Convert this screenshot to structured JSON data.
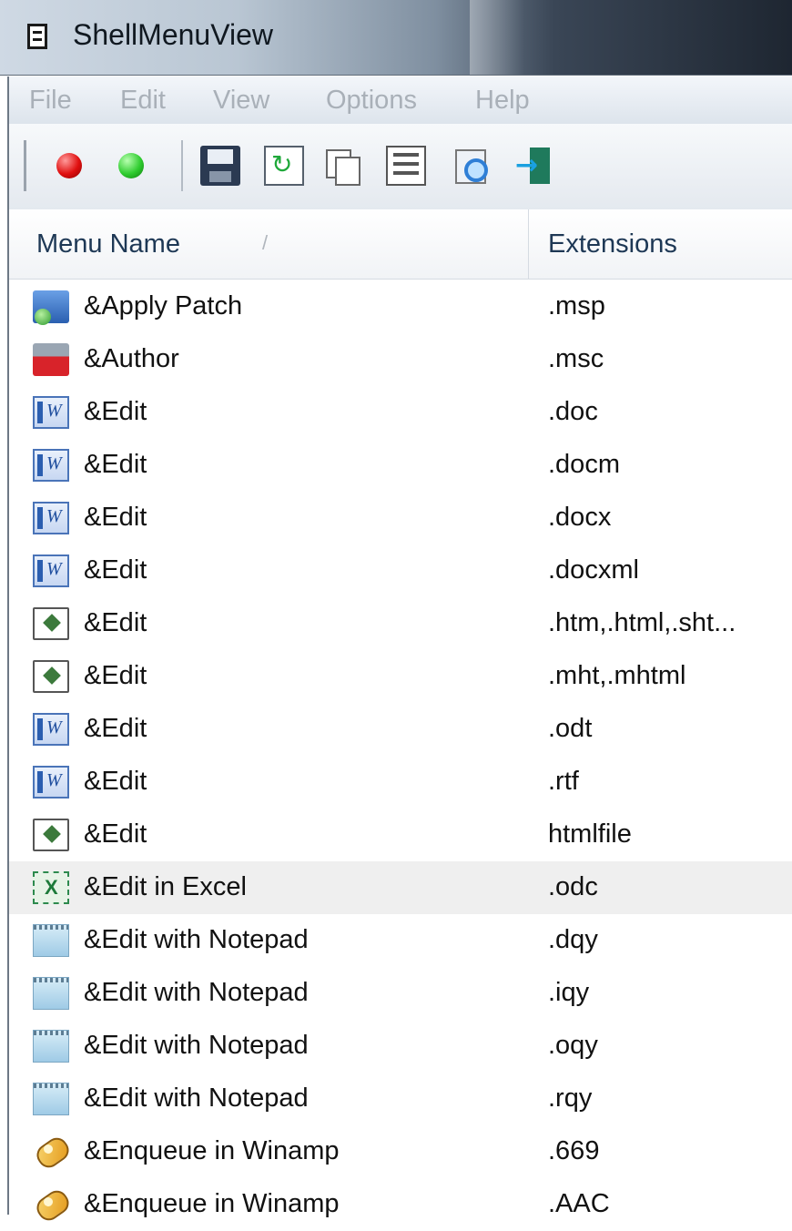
{
  "window": {
    "title": "ShellMenuView"
  },
  "menubar": {
    "items": [
      "File",
      "Edit",
      "View",
      "Options",
      "Help"
    ]
  },
  "toolbar": {
    "buttons": [
      "red-dot-icon",
      "green-dot-icon",
      "save-icon",
      "refresh-icon",
      "copy-icon",
      "properties-icon",
      "find-icon",
      "exit-icon"
    ]
  },
  "list": {
    "columns": [
      "Menu Name",
      "Extensions"
    ],
    "sort_indicator": "/",
    "rows": [
      {
        "name": "&Apply Patch",
        "ext": ".msp",
        "icon": "msi-patch-icon"
      },
      {
        "name": "&Author",
        "ext": ".msc",
        "icon": "mmc-author-icon"
      },
      {
        "name": "&Edit",
        "ext": ".doc",
        "icon": "word-icon"
      },
      {
        "name": "&Edit",
        "ext": ".docm",
        "icon": "word-icon"
      },
      {
        "name": "&Edit",
        "ext": ".docx",
        "icon": "word-icon"
      },
      {
        "name": "&Edit",
        "ext": ".docxml",
        "icon": "word-icon"
      },
      {
        "name": "&Edit",
        "ext": ".htm,.html,.sht...",
        "icon": "html-file-icon"
      },
      {
        "name": "&Edit",
        "ext": ".mht,.mhtml",
        "icon": "html-file-icon"
      },
      {
        "name": "&Edit",
        "ext": ".odt",
        "icon": "word-icon"
      },
      {
        "name": "&Edit",
        "ext": ".rtf",
        "icon": "word-icon"
      },
      {
        "name": "&Edit",
        "ext": "htmlfile",
        "icon": "html-file-icon"
      },
      {
        "name": "&Edit in Excel",
        "ext": ".odc",
        "icon": "excel-icon"
      },
      {
        "name": "&Edit with Notepad",
        "ext": ".dqy",
        "icon": "notepad-icon"
      },
      {
        "name": "&Edit with Notepad",
        "ext": ".iqy",
        "icon": "notepad-icon"
      },
      {
        "name": "&Edit with Notepad",
        "ext": ".oqy",
        "icon": "notepad-icon"
      },
      {
        "name": "&Edit with Notepad",
        "ext": ".rqy",
        "icon": "notepad-icon"
      },
      {
        "name": "&Enqueue in Winamp",
        "ext": ".669",
        "icon": "winamp-icon"
      },
      {
        "name": "&Enqueue in Winamp",
        "ext": ".AAC",
        "icon": "winamp-icon"
      }
    ]
  },
  "colors": {
    "selected_row": "#efefef",
    "header_text": "#1e3855",
    "menu_text_disabled": "#a9b0b8"
  }
}
